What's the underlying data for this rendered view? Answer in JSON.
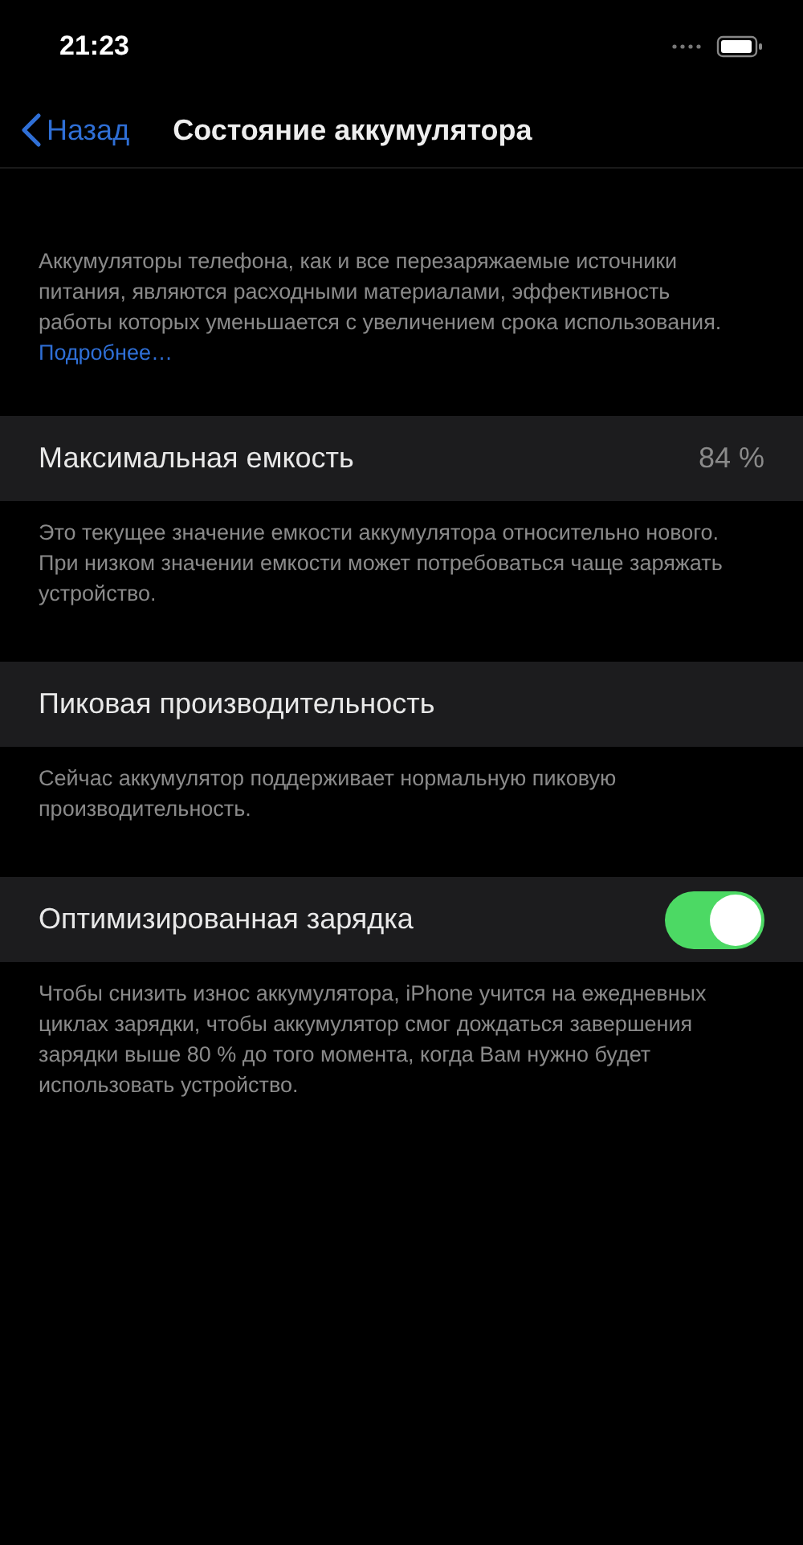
{
  "status_bar": {
    "time": "21:23"
  },
  "nav": {
    "back": "Назад",
    "title": "Состояние аккумулятора"
  },
  "intro": {
    "text": "Аккумуляторы телефона, как и все перезаряжаемые источники питания, являются расходными материалами, эффективность работы которых уменьшается с увеличением срока использования.",
    "link": "Подробнее…"
  },
  "sections": [
    {
      "kind": "value",
      "label": "Максимальная емкость",
      "value": "84 %",
      "footer": "Это текущее значение емкости аккумулятора относительно нового. При низком значении емкости может потребоваться чаще заряжать устройство."
    },
    {
      "kind": "plain",
      "label": "Пиковая производительность",
      "footer": "Сейчас аккумулятор поддерживает нормальную пиковую производительность."
    },
    {
      "kind": "toggle",
      "label": "Оптимизированная зарядка",
      "on": true,
      "footer": "Чтобы снизить износ аккумулятора, iPhone учится на ежедневных циклах зарядки, чтобы аккумулятор смог дождаться завершения зарядки выше 80 % до того момента, когда Вам нужно будет использовать устройство."
    }
  ]
}
